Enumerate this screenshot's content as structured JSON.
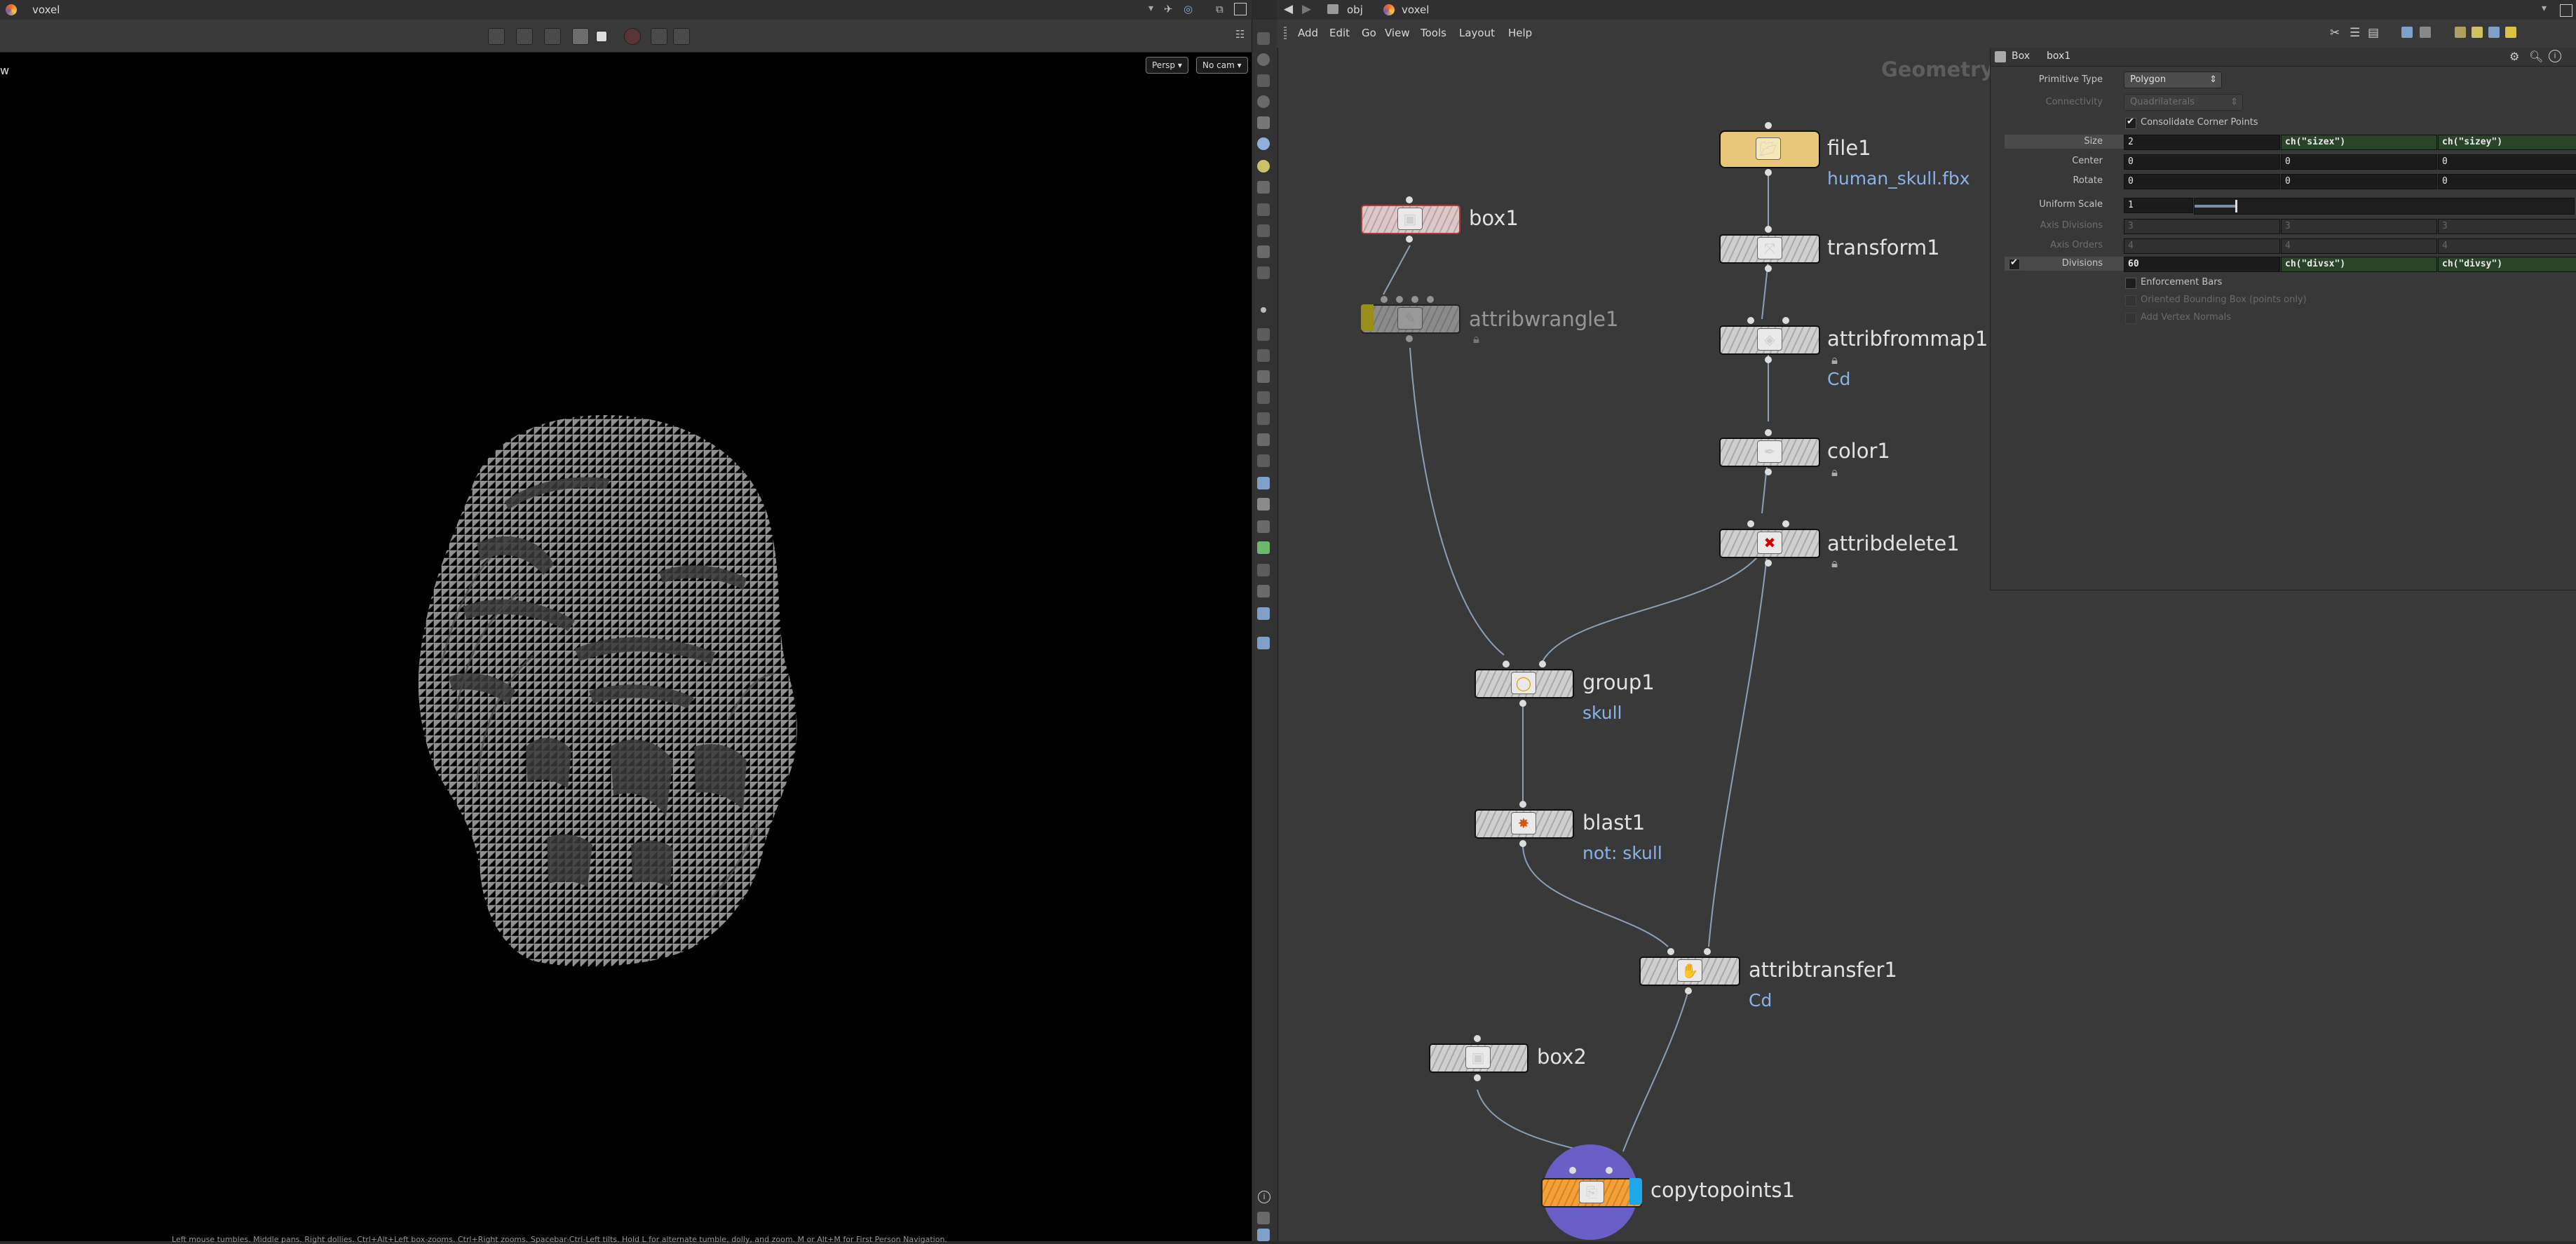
{
  "viewport": {
    "tab_label": "voxel",
    "pane_label": "w",
    "camera_label": "Persp",
    "cam_menu_label": "No cam",
    "status_hint": "Left mouse tumbles. Middle pans. Right dollies. Ctrl+Alt+Left box-zooms. Ctrl+Right zooms. Spacebar-Ctrl-Left tilts. Hold L for alternate tumble, dolly, and zoom. M or Alt+M for First Person Navigation."
  },
  "network": {
    "path": {
      "root": "obj",
      "current": "voxel"
    },
    "menus": [
      "Add",
      "Edit",
      "Go",
      "View",
      "Tools",
      "Layout",
      "Help"
    ],
    "context_label": "Geometry",
    "nodes": {
      "box1": {
        "name": "box1"
      },
      "attribwrangle1": {
        "name": "attribwrangle1"
      },
      "file1": {
        "name": "file1",
        "subtitle": "human_skull.fbx"
      },
      "transform1": {
        "name": "transform1"
      },
      "attribfrommap1": {
        "name": "attribfrommap1",
        "subtitle": "Cd"
      },
      "color1": {
        "name": "color1"
      },
      "attribdelete1": {
        "name": "attribdelete1"
      },
      "group1": {
        "name": "group1",
        "subtitle": "skull"
      },
      "blast1": {
        "name": "blast1",
        "subtitle": "not: skull"
      },
      "attribtransfer1": {
        "name": "attribtransfer1",
        "subtitle": "Cd"
      },
      "box2": {
        "name": "box2"
      },
      "copytopoints1": {
        "name": "copytopoints1"
      }
    }
  },
  "parameters": {
    "node_type": "Box",
    "node_name": "box1",
    "primitive_type": {
      "label": "Primitive Type",
      "value": "Polygon"
    },
    "connectivity": {
      "label": "Connectivity",
      "value": "Quadrilaterals"
    },
    "consolidate": {
      "label": "Consolidate Corner Points",
      "checked": true
    },
    "size": {
      "label": "Size",
      "x": "2",
      "y": "ch(\"sizex\")",
      "z": "ch(\"sizey\")"
    },
    "center": {
      "label": "Center",
      "x": "0",
      "y": "0",
      "z": "0"
    },
    "rotate": {
      "label": "Rotate",
      "x": "0",
      "y": "0",
      "z": "0"
    },
    "uniform_scale": {
      "label": "Uniform Scale",
      "value": "1"
    },
    "axis_divisions": {
      "label": "Axis Divisions",
      "x": "3",
      "y": "3",
      "z": "3"
    },
    "axis_orders": {
      "label": "Axis Orders",
      "x": "4",
      "y": "4",
      "z": "4"
    },
    "divisions": {
      "label": "Divisions",
      "x": "60",
      "y": "ch(\"divsx\")",
      "z": "ch(\"divsy\")"
    },
    "enforcement_bars": {
      "label": "Enforcement Bars"
    },
    "oriented_bbox": {
      "label": "Oriented Bounding Box (points only)"
    },
    "vertex_normals": {
      "label": "Add Vertex Normals"
    }
  }
}
